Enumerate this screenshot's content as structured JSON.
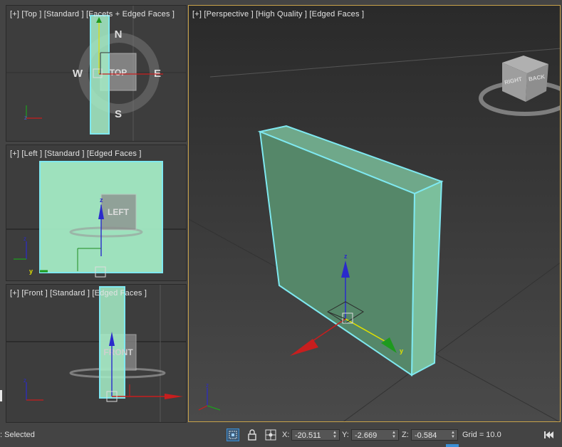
{
  "viewports": {
    "top": {
      "label": "[+] [Top ] [Standard ] [Facets + Edged Faces ]",
      "compass": {
        "n": "N",
        "s": "S",
        "e": "E",
        "w": "W"
      },
      "cube_label": "TOP"
    },
    "left": {
      "label": "[+] [Left ] [Standard ] [Edged Faces ]",
      "cube_label": "LEFT",
      "axis_z": "z",
      "axis_y": "y"
    },
    "front": {
      "label": "[+] [Front ] [Standard ] [Edged Faces ]",
      "cube_label": "FRONT",
      "axis_z": "z"
    },
    "perspective": {
      "label": "[+] [Perspective ] [High Quality ] [Edged Faces ]",
      "cube_right": "RIGHT",
      "cube_back": "BACK",
      "axis_z": "z",
      "axis_y": "y"
    }
  },
  "status_bar": {
    "selection_text": ": Selected",
    "x_label": "X:",
    "x_value": "-20.511",
    "y_label": "Y:",
    "y_value": "-2.669",
    "z_label": "Z:",
    "z_value": "-0.584",
    "grid_text": "Grid = 10.0"
  },
  "colors": {
    "selection_cyan": "#7fe8f0",
    "object_fill": "#a6efc8",
    "active_border": "#c8a24a"
  }
}
